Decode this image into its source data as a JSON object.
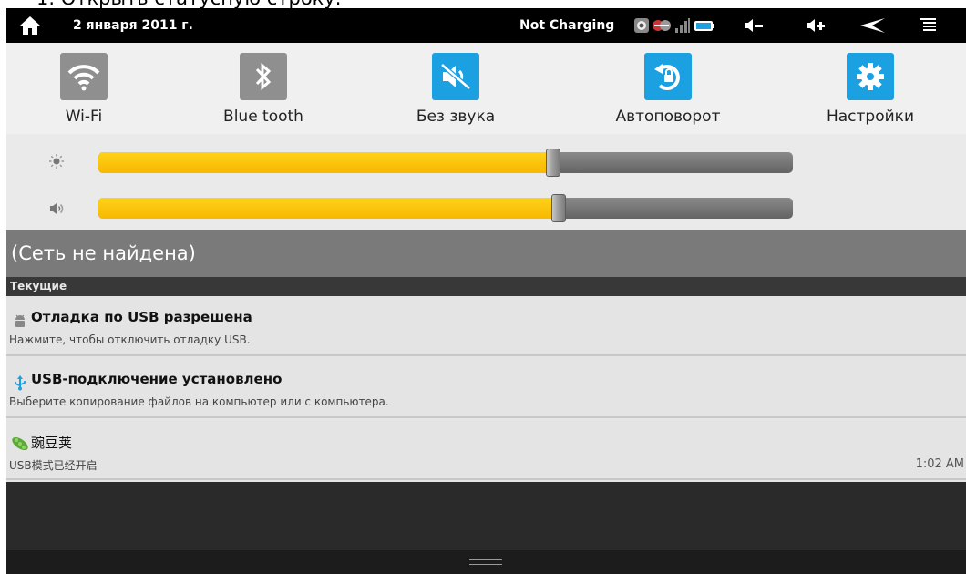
{
  "top_caption": "1. Открыть статусную строку.",
  "status_bar": {
    "date": "2 января 2011 г.",
    "charge_status": "Not Charging",
    "icons": [
      "home-icon",
      "usb-debug-icon",
      "usb-connected-icon",
      "signal-icon",
      "battery-icon",
      "volume-down-icon",
      "volume-up-icon",
      "back-icon",
      "menu-icon"
    ]
  },
  "quick_settings": [
    {
      "label": "Wi-Fi",
      "icon": "wifi-icon",
      "state": "off"
    },
    {
      "label": "Blue tooth",
      "icon": "bluetooth-icon",
      "state": "off"
    },
    {
      "label": "Без звука",
      "icon": "mute-icon",
      "state": "on"
    },
    {
      "label": "Автоповорот",
      "icon": "rotate-icon",
      "state": "on"
    },
    {
      "label": "Настройки",
      "icon": "settings-icon",
      "state": "on"
    }
  ],
  "sliders": {
    "brightness": {
      "icon": "brightness-icon",
      "level": 0.655
    },
    "volume": {
      "icon": "volume-icon",
      "level": 0.663
    }
  },
  "network_status": "(Сеть не найдена)",
  "section_header": "Текущие",
  "notifications": [
    {
      "icon": "android-debug-icon",
      "title": "Отладка по USB разрешена",
      "subtitle": "Нажмите, чтобы отключить отладку USB.",
      "time": ""
    },
    {
      "icon": "usb-icon",
      "title": "USB-подключение установлено",
      "subtitle": "Выберите копирование файлов на компьютер или с компьютера.",
      "time": ""
    },
    {
      "icon": "pea-icon",
      "title": "豌豆荚",
      "subtitle": "USB模式已经开启",
      "time": "1:02 AM"
    }
  ],
  "colors": {
    "accent_on": "#1ba0e1",
    "tile_off": "#8f8f8f",
    "slider_fill": "#f7b800"
  }
}
